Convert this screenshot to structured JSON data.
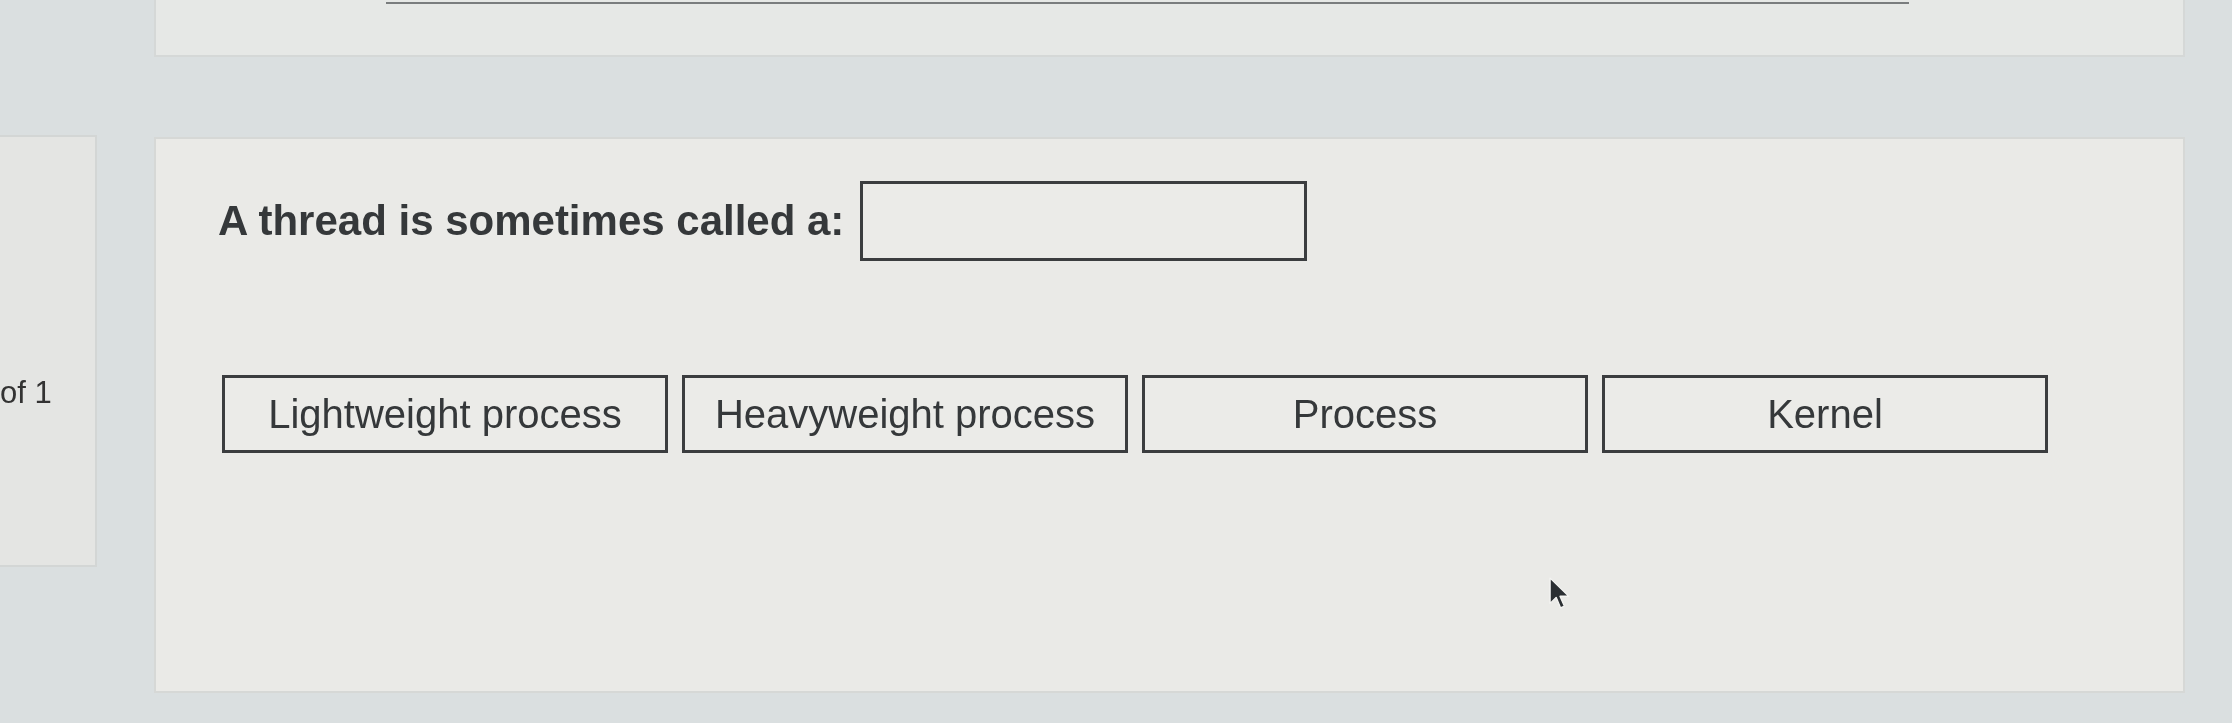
{
  "sidebar": {
    "counter": "of 1"
  },
  "question": {
    "kind": "fill_in",
    "prompt": "A thread is sometimes called a:"
  },
  "options": [
    {
      "label": "Lightweight process"
    },
    {
      "label": "Heavyweight process"
    },
    {
      "label": "Process"
    },
    {
      "label": "Kernel"
    }
  ]
}
